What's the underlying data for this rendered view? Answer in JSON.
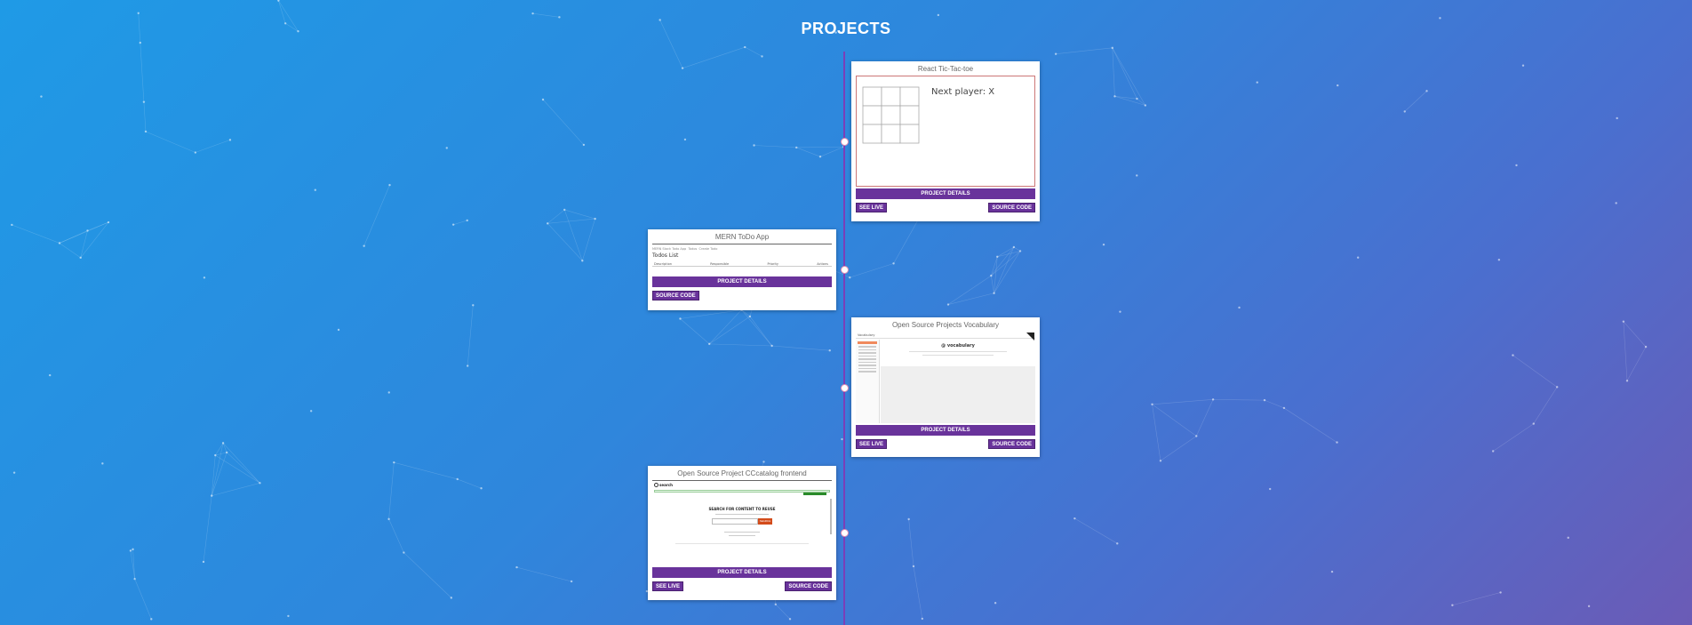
{
  "page": {
    "title": "PROJECTS",
    "accent": "#69339b",
    "timeline_color": "#7b3fb8"
  },
  "projects": [
    {
      "title": "React Tic-Tac-toe",
      "details_label": "PROJECT DETAILS",
      "see_live_label": "SEE LIVE",
      "source_label": "SOURCE CODE",
      "preview": {
        "status_text": "Next player: X"
      }
    },
    {
      "title": "MERN ToDo App",
      "details_label": "PROJECT DETAILS",
      "source_label": "SOURCE CODE",
      "preview": {
        "nav": "MERN Stack Todo App",
        "nav_links": [
          "Todos",
          "Create Todo"
        ],
        "heading": "Todos List",
        "columns": [
          "Description",
          "Responsible",
          "Priority",
          "Actions"
        ]
      }
    },
    {
      "title": "Open Source Projects Vocabulary",
      "details_label": "PROJECT DETAILS",
      "see_live_label": "SEE LIVE",
      "source_label": "SOURCE CODE",
      "preview": {
        "brand": "Vocabulary",
        "logo_text": "@ vocabulary"
      }
    },
    {
      "title": "Open Source Project CCcatalog frontend",
      "details_label": "PROJECT DETAILS",
      "see_live_label": "SEE LIVE",
      "source_label": "SOURCE CODE",
      "preview": {
        "logo": "search",
        "heading": "SEARCH FOR CONTENT TO REUSE",
        "button": "SEARCH"
      }
    }
  ]
}
